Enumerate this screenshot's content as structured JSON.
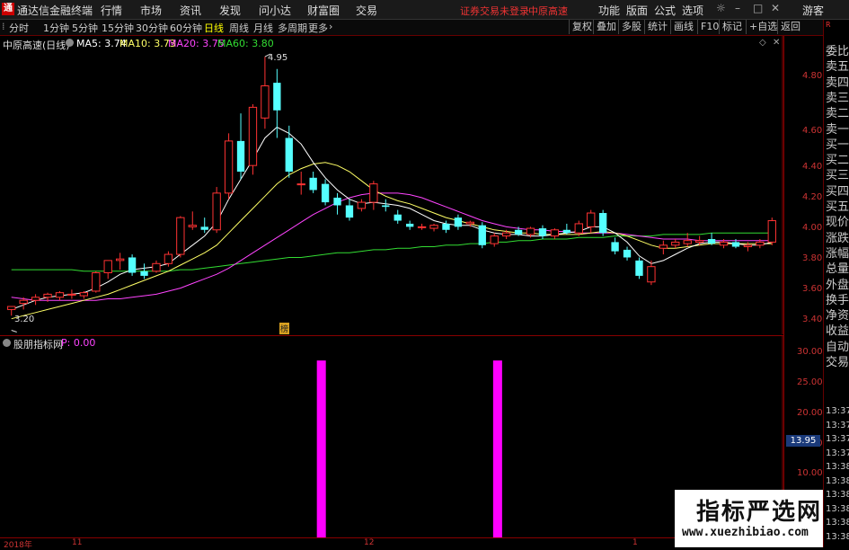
{
  "app": {
    "logo_glyph": "通",
    "title": "通达信金融终端",
    "menu": [
      "行情",
      "市场",
      "资讯",
      "发现",
      "问小达",
      "财富圈",
      "交易"
    ],
    "status_text": "证券交易未登录",
    "broker": "中原高速",
    "right_menu": [
      "功能",
      "版面",
      "公式",
      "选项"
    ],
    "guest": "游客"
  },
  "toolbar": {
    "periods": [
      "分时",
      "1分钟",
      "5分钟",
      "15分钟",
      "30分钟",
      "60分钟",
      "日线",
      "周线",
      "月线",
      "多周期",
      "更多"
    ],
    "active_period": "日线",
    "right_buttons": [
      "复权",
      "叠加",
      "多股",
      "统计",
      "画线",
      "F10",
      "标记",
      "+自选",
      "返回"
    ]
  },
  "main_chart": {
    "stock_title": "中原高速(日线)",
    "ma_labels": [
      {
        "text": "MA5: 3.74",
        "color": "#ffffff"
      },
      {
        "text": "MA10: 3.73",
        "color": "#ffff66"
      },
      {
        "text": "MA20: 3.75",
        "color": "#ff44ff"
      },
      {
        "text": "MA60: 3.80",
        "color": "#33dd33"
      }
    ],
    "high_marker": "4.95",
    "low_marker": "3.20",
    "event_tag": "榜",
    "y_ticks": [
      "4.80",
      "4.60",
      "4.40",
      "4.20",
      "4.00",
      "3.80",
      "3.60",
      "3.40",
      "3.20"
    ]
  },
  "indicator": {
    "title": "股朋指标网",
    "param": "P: 0.00",
    "y_ticks": [
      "30.00",
      "25.00",
      "20.00",
      "15.00",
      "10.00"
    ],
    "current_value": "13.95"
  },
  "side_panel": {
    "labels": [
      "委比",
      "卖五",
      "卖四",
      "卖三",
      "卖二",
      "卖一",
      "买一",
      "买二",
      "买三",
      "买四",
      "买五",
      "现价",
      "涨跌",
      "涨幅",
      "总量",
      "外盘",
      "换手",
      "净资",
      "收益",
      "自动",
      "交易"
    ],
    "times": [
      "13:37",
      "13:37",
      "13:37",
      "13:37",
      "13:38",
      "13:38",
      "13:38",
      "13:38",
      "13:38",
      "13:38"
    ]
  },
  "date_axis": [
    "2018年",
    "11",
    "12",
    "1"
  ],
  "watermark": {
    "title": "指标严选网",
    "url": "www.xuezhibiao.com"
  },
  "colors": {
    "up": "#ff3333",
    "down": "#55ffff",
    "ma5": "#ffffff",
    "ma10": "#ffff66",
    "ma20": "#ff44ff",
    "ma60": "#33dd33",
    "bar": "#ff00ff"
  },
  "chart_data": {
    "type": "candlestick",
    "ylim": [
      3.15,
      4.98
    ],
    "candles": [
      {
        "o": 3.3,
        "h": 3.32,
        "l": 3.26,
        "c": 3.32
      },
      {
        "o": 3.34,
        "h": 3.38,
        "l": 3.3,
        "c": 3.36
      },
      {
        "o": 3.36,
        "h": 3.4,
        "l": 3.33,
        "c": 3.38
      },
      {
        "o": 3.38,
        "h": 3.41,
        "l": 3.35,
        "c": 3.4
      },
      {
        "o": 3.38,
        "h": 3.42,
        "l": 3.36,
        "c": 3.41
      },
      {
        "o": 3.4,
        "h": 3.43,
        "l": 3.37,
        "c": 3.4
      },
      {
        "o": 3.39,
        "h": 3.42,
        "l": 3.37,
        "c": 3.41
      },
      {
        "o": 3.42,
        "h": 3.55,
        "l": 3.41,
        "c": 3.54
      },
      {
        "o": 3.54,
        "h": 3.62,
        "l": 3.5,
        "c": 3.62
      },
      {
        "o": 3.62,
        "h": 3.67,
        "l": 3.56,
        "c": 3.63
      },
      {
        "o": 3.64,
        "h": 3.66,
        "l": 3.52,
        "c": 3.54
      },
      {
        "o": 3.55,
        "h": 3.6,
        "l": 3.5,
        "c": 3.52
      },
      {
        "o": 3.55,
        "h": 3.62,
        "l": 3.54,
        "c": 3.6
      },
      {
        "o": 3.6,
        "h": 3.68,
        "l": 3.58,
        "c": 3.66
      },
      {
        "o": 3.66,
        "h": 3.91,
        "l": 3.64,
        "c": 3.9
      },
      {
        "o": 3.84,
        "h": 3.94,
        "l": 3.82,
        "c": 3.85
      },
      {
        "o": 3.84,
        "h": 3.9,
        "l": 3.8,
        "c": 3.82
      },
      {
        "o": 3.82,
        "h": 4.1,
        "l": 3.8,
        "c": 4.06
      },
      {
        "o": 4.06,
        "h": 4.45,
        "l": 4.02,
        "c": 4.4
      },
      {
        "o": 4.4,
        "h": 4.58,
        "l": 4.15,
        "c": 4.2
      },
      {
        "o": 4.24,
        "h": 4.64,
        "l": 4.18,
        "c": 4.62
      },
      {
        "o": 4.55,
        "h": 4.95,
        "l": 4.48,
        "c": 4.76
      },
      {
        "o": 4.78,
        "h": 4.87,
        "l": 4.42,
        "c": 4.6
      },
      {
        "o": 4.42,
        "h": 4.5,
        "l": 4.16,
        "c": 4.2
      },
      {
        "o": 4.12,
        "h": 4.2,
        "l": 4.05,
        "c": 4.12
      },
      {
        "o": 4.16,
        "h": 4.2,
        "l": 4.06,
        "c": 4.08
      },
      {
        "o": 4.12,
        "h": 4.15,
        "l": 3.98,
        "c": 4.0
      },
      {
        "o": 4.03,
        "h": 4.06,
        "l": 3.92,
        "c": 3.98
      },
      {
        "o": 3.98,
        "h": 4.02,
        "l": 3.88,
        "c": 3.9
      },
      {
        "o": 3.96,
        "h": 4.02,
        "l": 3.94,
        "c": 4.0
      },
      {
        "o": 4.0,
        "h": 4.14,
        "l": 3.95,
        "c": 4.12
      },
      {
        "o": 3.98,
        "h": 4.02,
        "l": 3.94,
        "c": 3.97
      },
      {
        "o": 3.92,
        "h": 3.95,
        "l": 3.86,
        "c": 3.88
      },
      {
        "o": 3.86,
        "h": 3.88,
        "l": 3.82,
        "c": 3.84
      },
      {
        "o": 3.84,
        "h": 3.86,
        "l": 3.82,
        "c": 3.84
      },
      {
        "o": 3.83,
        "h": 3.86,
        "l": 3.81,
        "c": 3.85
      },
      {
        "o": 3.86,
        "h": 3.88,
        "l": 3.8,
        "c": 3.82
      },
      {
        "o": 3.9,
        "h": 3.92,
        "l": 3.82,
        "c": 3.84
      },
      {
        "o": 3.86,
        "h": 3.88,
        "l": 3.84,
        "c": 3.87
      },
      {
        "o": 3.85,
        "h": 3.87,
        "l": 3.7,
        "c": 3.72
      },
      {
        "o": 3.73,
        "h": 3.8,
        "l": 3.71,
        "c": 3.78
      },
      {
        "o": 3.78,
        "h": 3.82,
        "l": 3.76,
        "c": 3.8
      },
      {
        "o": 3.82,
        "h": 3.84,
        "l": 3.78,
        "c": 3.79
      },
      {
        "o": 3.79,
        "h": 3.84,
        "l": 3.77,
        "c": 3.83
      },
      {
        "o": 3.83,
        "h": 3.85,
        "l": 3.76,
        "c": 3.78
      },
      {
        "o": 3.78,
        "h": 3.83,
        "l": 3.76,
        "c": 3.82
      },
      {
        "o": 3.82,
        "h": 3.86,
        "l": 3.79,
        "c": 3.8
      },
      {
        "o": 3.8,
        "h": 3.88,
        "l": 3.78,
        "c": 3.86
      },
      {
        "o": 3.84,
        "h": 3.95,
        "l": 3.8,
        "c": 3.93
      },
      {
        "o": 3.93,
        "h": 3.95,
        "l": 3.78,
        "c": 3.8
      },
      {
        "o": 3.74,
        "h": 3.77,
        "l": 3.66,
        "c": 3.68
      },
      {
        "o": 3.69,
        "h": 3.71,
        "l": 3.62,
        "c": 3.64
      },
      {
        "o": 3.62,
        "h": 3.64,
        "l": 3.5,
        "c": 3.52
      },
      {
        "o": 3.48,
        "h": 3.62,
        "l": 3.46,
        "c": 3.58
      },
      {
        "o": 3.7,
        "h": 3.75,
        "l": 3.66,
        "c": 3.72
      },
      {
        "o": 3.72,
        "h": 3.76,
        "l": 3.7,
        "c": 3.74
      },
      {
        "o": 3.73,
        "h": 3.8,
        "l": 3.71,
        "c": 3.75
      },
      {
        "o": 3.74,
        "h": 3.78,
        "l": 3.72,
        "c": 3.75
      },
      {
        "o": 3.76,
        "h": 3.8,
        "l": 3.72,
        "c": 3.73
      },
      {
        "o": 3.72,
        "h": 3.76,
        "l": 3.7,
        "c": 3.74
      },
      {
        "o": 3.74,
        "h": 3.76,
        "l": 3.7,
        "c": 3.71
      },
      {
        "o": 3.71,
        "h": 3.74,
        "l": 3.68,
        "c": 3.72
      },
      {
        "o": 3.72,
        "h": 3.76,
        "l": 3.7,
        "c": 3.74
      },
      {
        "o": 3.74,
        "h": 3.9,
        "l": 3.72,
        "c": 3.88
      }
    ],
    "ma5": [
      3.3,
      3.33,
      3.36,
      3.38,
      3.39,
      3.4,
      3.41,
      3.44,
      3.48,
      3.53,
      3.56,
      3.57,
      3.58,
      3.6,
      3.66,
      3.72,
      3.78,
      3.87,
      4.02,
      4.15,
      4.28,
      4.42,
      4.49,
      4.45,
      4.38,
      4.26,
      4.16,
      4.08,
      4.02,
      3.99,
      4.0,
      3.99,
      3.98,
      3.96,
      3.92,
      3.88,
      3.86,
      3.85,
      3.85,
      3.82,
      3.8,
      3.79,
      3.79,
      3.78,
      3.78,
      3.79,
      3.8,
      3.81,
      3.84,
      3.84,
      3.8,
      3.74,
      3.65,
      3.6,
      3.62,
      3.66,
      3.7,
      3.73,
      3.74,
      3.74,
      3.73,
      3.72,
      3.72,
      3.74
    ],
    "ma10": [
      3.24,
      3.26,
      3.28,
      3.3,
      3.32,
      3.34,
      3.36,
      3.38,
      3.4,
      3.43,
      3.46,
      3.49,
      3.52,
      3.55,
      3.59,
      3.63,
      3.67,
      3.72,
      3.8,
      3.88,
      3.96,
      4.04,
      4.12,
      4.18,
      4.22,
      4.25,
      4.26,
      4.24,
      4.2,
      4.14,
      4.08,
      4.04,
      4.01,
      3.99,
      3.96,
      3.93,
      3.9,
      3.88,
      3.86,
      3.84,
      3.82,
      3.81,
      3.8,
      3.8,
      3.79,
      3.79,
      3.79,
      3.79,
      3.8,
      3.81,
      3.8,
      3.78,
      3.75,
      3.72,
      3.7,
      3.7,
      3.71,
      3.72,
      3.73,
      3.73,
      3.73,
      3.73,
      3.73,
      3.73
    ],
    "ma20": [
      3.38,
      3.37,
      3.36,
      3.36,
      3.36,
      3.36,
      3.36,
      3.36,
      3.37,
      3.37,
      3.38,
      3.39,
      3.4,
      3.42,
      3.44,
      3.47,
      3.5,
      3.53,
      3.57,
      3.62,
      3.67,
      3.72,
      3.77,
      3.82,
      3.87,
      3.92,
      3.96,
      4.0,
      4.03,
      4.05,
      4.06,
      4.06,
      4.06,
      4.05,
      4.03,
      4.0,
      3.97,
      3.94,
      3.91,
      3.88,
      3.86,
      3.84,
      3.83,
      3.82,
      3.82,
      3.81,
      3.81,
      3.8,
      3.8,
      3.8,
      3.8,
      3.79,
      3.78,
      3.77,
      3.76,
      3.76,
      3.76,
      3.75,
      3.75,
      3.75,
      3.75,
      3.75,
      3.75,
      3.75
    ],
    "ma60": [
      3.56,
      3.56,
      3.56,
      3.56,
      3.56,
      3.56,
      3.55,
      3.55,
      3.55,
      3.55,
      3.55,
      3.55,
      3.55,
      3.55,
      3.56,
      3.56,
      3.57,
      3.58,
      3.59,
      3.6,
      3.61,
      3.62,
      3.63,
      3.64,
      3.64,
      3.65,
      3.66,
      3.67,
      3.67,
      3.68,
      3.69,
      3.69,
      3.7,
      3.7,
      3.71,
      3.71,
      3.72,
      3.72,
      3.73,
      3.73,
      3.74,
      3.74,
      3.75,
      3.75,
      3.76,
      3.76,
      3.76,
      3.77,
      3.77,
      3.77,
      3.78,
      3.78,
      3.78,
      3.78,
      3.79,
      3.79,
      3.79,
      3.79,
      3.8,
      3.8,
      3.8,
      3.8,
      3.8,
      3.8
    ],
    "indicator_bars": [
      {
        "index": 26,
        "value": 30
      },
      {
        "index": 41,
        "value": 30
      }
    ],
    "indicator_ylim": [
      0,
      32
    ]
  }
}
